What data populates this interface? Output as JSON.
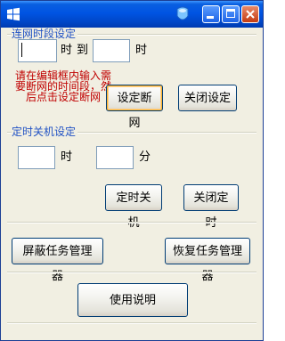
{
  "window": {
    "title": "",
    "icons": {
      "app": "windows-logo-icon",
      "tray": "tray-app-icon",
      "minimize": "minimize-icon",
      "maximize": "maximize-icon",
      "close": "close-icon"
    },
    "colors": {
      "titlebar": "#0054e3",
      "group_label": "#2152c4",
      "hint": "#c00000",
      "face": "#f1efe2"
    }
  },
  "network": {
    "group_title": "连网时段设定",
    "hour_value": "",
    "hour_unit": "时",
    "to_label": "到",
    "end_value": "",
    "end_unit": "时",
    "hint_text": "请在编辑框内输入需要断网的时间段，然后点击设定断网",
    "set_button": "设定断网",
    "close_button": "关闭设定"
  },
  "shutdown": {
    "group_title": "定时关机设定",
    "hour_value": "",
    "hour_unit": "时",
    "minute_value": "",
    "minute_unit": "分",
    "set_button": "定时关机",
    "close_button": "关闭定时"
  },
  "taskmgr": {
    "disable_button": "屏蔽任务管理器",
    "restore_button": "恢复任务管理器"
  },
  "help": {
    "button": "使用说明"
  }
}
